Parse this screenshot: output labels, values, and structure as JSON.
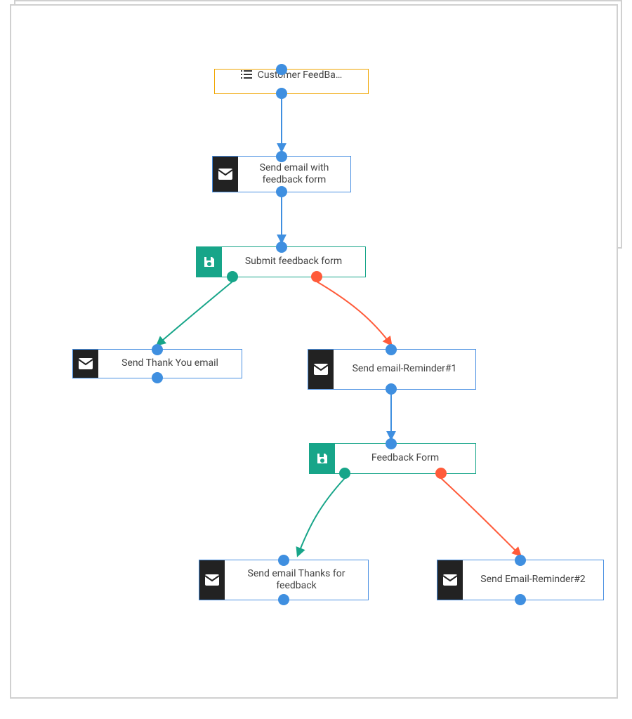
{
  "colors": {
    "blue": "#3f8fe0",
    "teal": "#17a589",
    "orange": "#ff5b3a"
  },
  "nodes": {
    "root": {
      "label": "Customer FeedBa…"
    },
    "email1": {
      "label": "Send email with feedback form"
    },
    "form1": {
      "label": "Submit feedback form"
    },
    "thanks1": {
      "label": "Send Thank You email"
    },
    "reminder1": {
      "label": "Send email-Reminder#1"
    },
    "form2": {
      "label": "Feedback Form"
    },
    "thanks2": {
      "label": "Send email Thanks for feedback"
    },
    "reminder2": {
      "label": "Send Email-Reminder#2"
    }
  }
}
